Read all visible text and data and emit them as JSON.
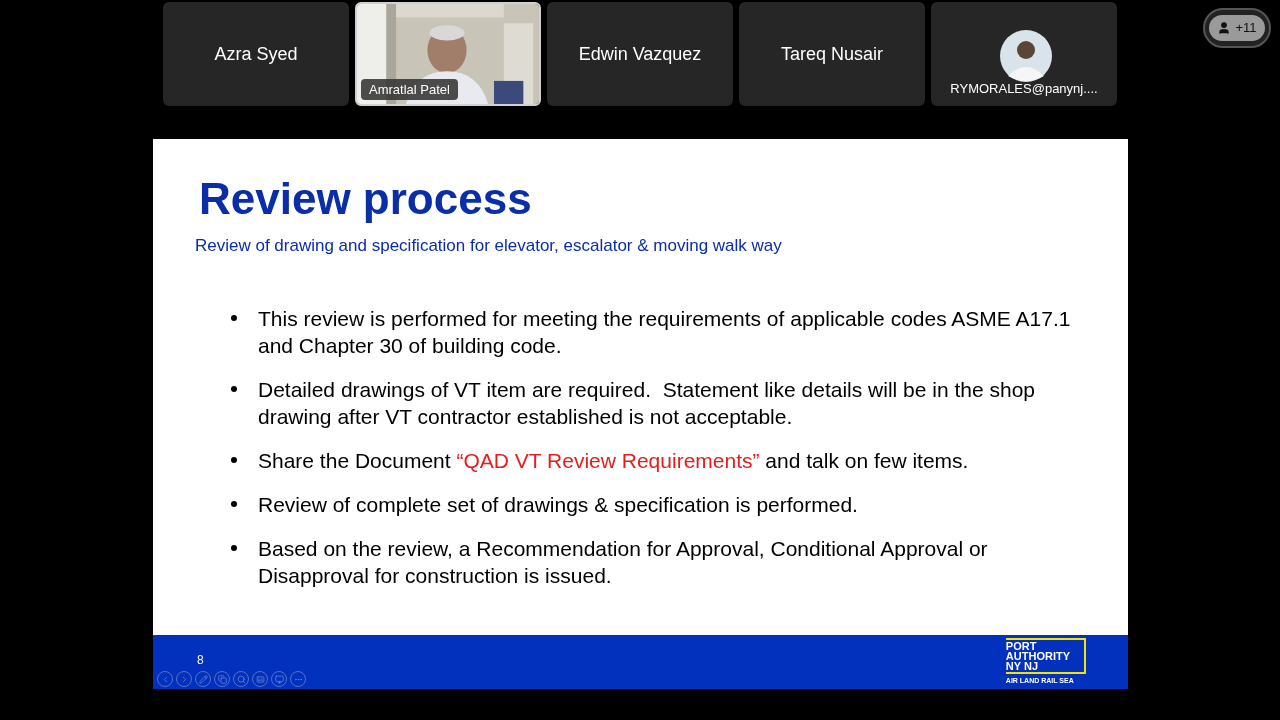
{
  "participants": [
    {
      "kind": "name",
      "name": "Azra Syed",
      "selected": false
    },
    {
      "kind": "video",
      "name": "Amratlal Patel",
      "selected": true
    },
    {
      "kind": "name",
      "name": "Edwin Vazquez",
      "selected": false
    },
    {
      "kind": "name",
      "name": "Tareq Nusair",
      "selected": false
    },
    {
      "kind": "avatar",
      "name": "RYMORALES@panynj....",
      "selected": false
    }
  ],
  "more_participants": "+11",
  "slide": {
    "title": "Review process",
    "subtitle": "Review of drawing and specification for elevator, escalator & moving walk way",
    "bullets": [
      {
        "parts": [
          {
            "text": "This review is performed for meeting the requirements of applicable codes ASME A17.1 and Chapter 30 of building code.",
            "emphasis": false
          }
        ]
      },
      {
        "parts": [
          {
            "text": "Detailed drawings of VT item are required.  Statement like details will be in the shop drawing after VT contractor established is not acceptable.",
            "emphasis": false
          }
        ]
      },
      {
        "parts": [
          {
            "text": "Share the Document ",
            "emphasis": false
          },
          {
            "text": "“QAD VT Review Requirements”",
            "emphasis": true
          },
          {
            "text": " and talk on few items.",
            "emphasis": false
          }
        ]
      },
      {
        "parts": [
          {
            "text": "Review of complete set of drawings & specification is performed.",
            "emphasis": false
          }
        ]
      },
      {
        "parts": [
          {
            "text": "Based on the review, a Recommendation for Approval, Conditional Approval or  Disapproval for construction is issued.",
            "emphasis": false
          }
        ]
      }
    ],
    "page_number": "8",
    "logo": {
      "lines": [
        "PORT",
        "AUTHORITY",
        "NY NJ"
      ],
      "tagline": "AIR LAND RAIL SEA"
    }
  }
}
